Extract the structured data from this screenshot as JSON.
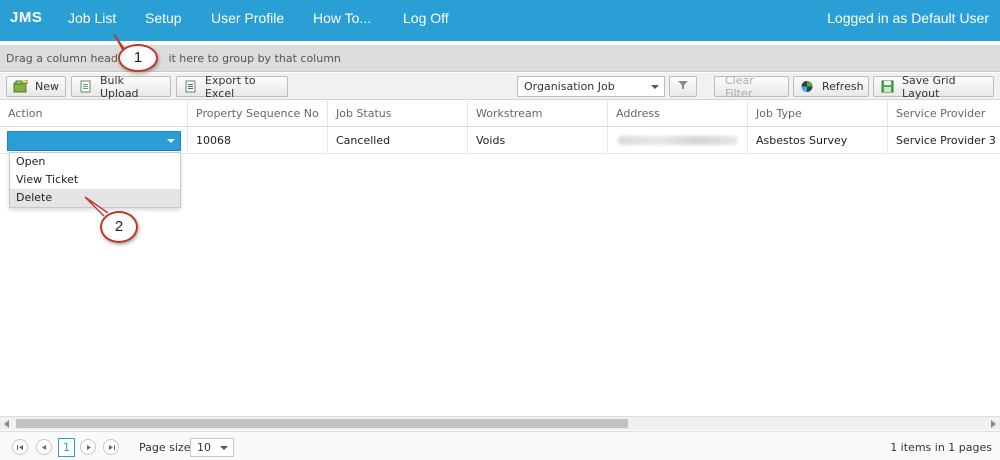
{
  "topbar": {
    "brand": "JMS",
    "nav": [
      "Job List",
      "Setup",
      "User Profile",
      "How To...",
      "Log Off"
    ],
    "logged_in": "Logged in as Default User",
    "bg_color": "#2a9fd6"
  },
  "group_panel": {
    "hint_part1": "Drag a column header a",
    "hint_part2": "it here to group by that column"
  },
  "toolbar": {
    "new_label": "New",
    "bulk_upload_label": "Bulk Upload",
    "export_label": "Export to Excel",
    "view_select_value": "Organisation Job",
    "clear_filter_label": "Clear Filter",
    "refresh_label": "Refresh",
    "save_layout_label": "Save Grid Layout"
  },
  "grid": {
    "columns": [
      "Action",
      "Property Sequence No",
      "Job Status",
      "Workstream",
      "Address",
      "Job Type",
      "Service Provider"
    ],
    "rows": [
      {
        "property_sequence_no": "10068",
        "job_status": "Cancelled",
        "workstream": "Voids",
        "address": "",
        "job_type": "Asbestos Survey",
        "service_provider": "Service Provider 3"
      }
    ]
  },
  "action_menu": {
    "items": [
      "Open",
      "View Ticket",
      "Delete"
    ],
    "highlighted": "Delete"
  },
  "callouts": [
    "1",
    "2"
  ],
  "pager": {
    "current_page": "1",
    "page_size_label": "Page size:",
    "page_size_value": "10",
    "items_count": "1",
    "items_text_1": " items in ",
    "pages_count": "1",
    "items_text_2": " pages"
  }
}
